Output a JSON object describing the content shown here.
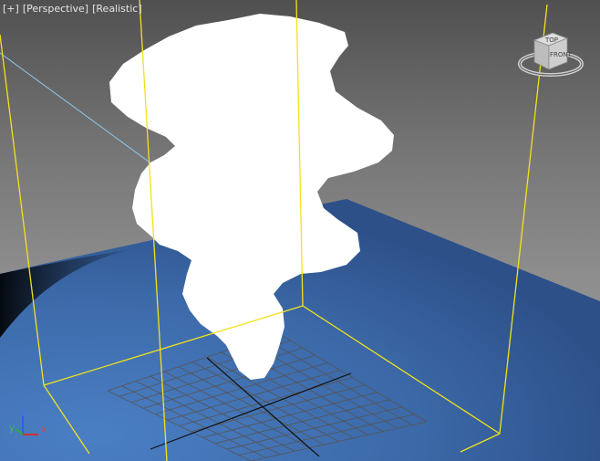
{
  "viewport": {
    "labels": {
      "plus": "[+]",
      "perspective": "[Perspective]",
      "shading": "[Realistic]"
    }
  },
  "viewcube": {
    "top_face": "TOP",
    "front_face": "FRONT"
  },
  "axis_tripod": {
    "x": "x",
    "y": "y",
    "z": "z"
  },
  "colors": {
    "ground": "#3f6fb0",
    "bounding_box": "#f2e21a",
    "smoke": "#ffffff",
    "grid": "#555555",
    "axis_x": "#d03030",
    "axis_y": "#30b030",
    "axis_z": "#3060e0"
  },
  "icons": [
    "viewcube-icon",
    "axis-tripod-icon"
  ]
}
